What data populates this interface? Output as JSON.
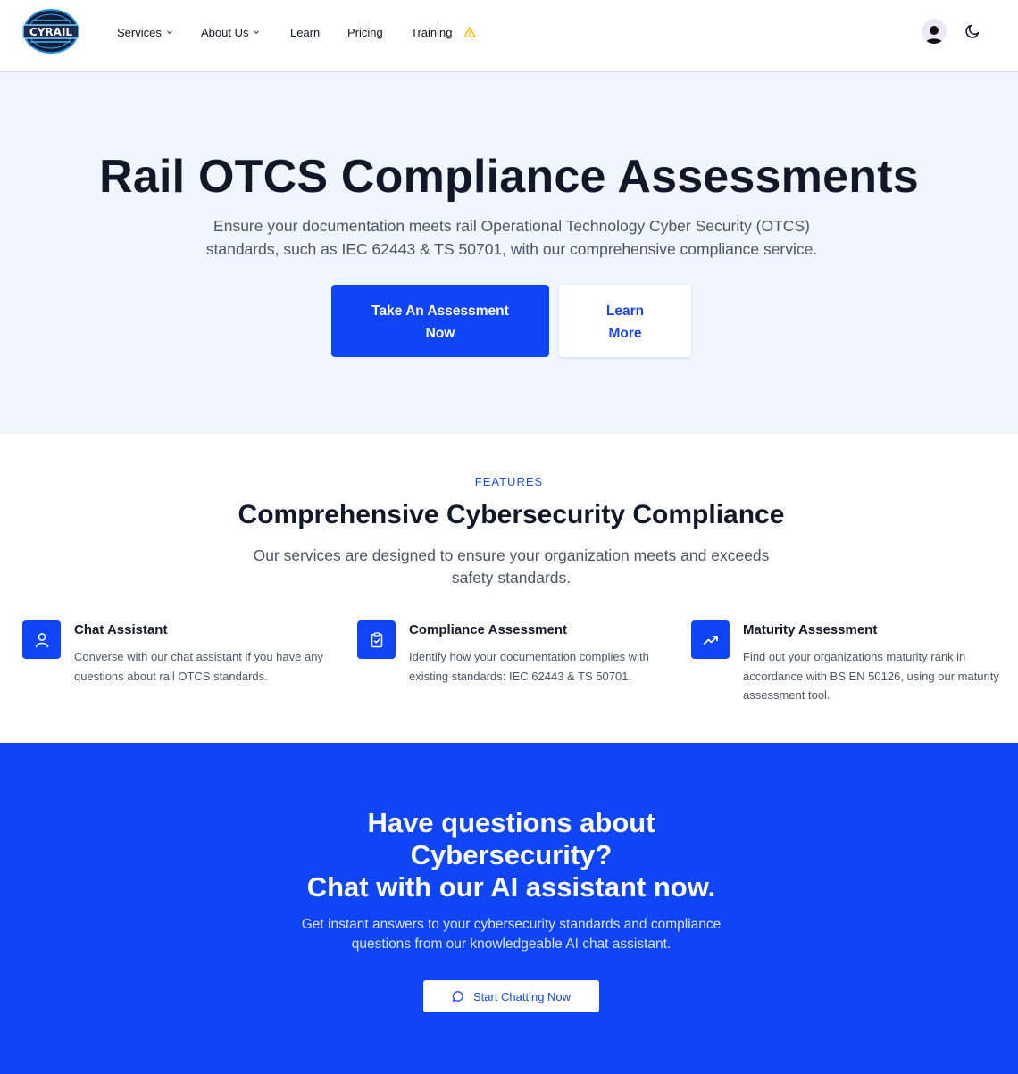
{
  "brand": {
    "logo_text": "CYRAIL"
  },
  "nav": {
    "items": [
      {
        "label": "Services"
      },
      {
        "label": "About Us"
      },
      {
        "label": "Learn"
      },
      {
        "label": "Pricing"
      },
      {
        "label": "Training"
      }
    ]
  },
  "hero": {
    "title": "Rail OTCS Compliance Assessments",
    "subtitle": "Ensure your documentation meets rail Operational Technology Cyber Security (OTCS) standards, such as IEC 62443 & TS 50701, with our comprehensive compliance service.",
    "primary_button": "Take An Assessment Now",
    "secondary_button": "Learn More"
  },
  "features": {
    "eyebrow": "FEATURES",
    "title": "Comprehensive Cybersecurity Compliance",
    "subtitle": "Our services are designed to ensure your organization meets and exceeds safety standards.",
    "cards": [
      {
        "icon": "user-icon",
        "title": "Chat Assistant",
        "description": "Converse with our chat assistant if you have any questions about rail OTCS standards."
      },
      {
        "icon": "clipboard-check-icon",
        "title": "Compliance Assessment",
        "description": "Identify how your documentation complies with existing standards: IEC 62443 & TS 50701."
      },
      {
        "icon": "trending-up-icon",
        "title": "Maturity Assessment",
        "description": "Find out your organizations maturity rank in accordance with BS EN 50126, using our maturity assessment tool."
      }
    ]
  },
  "cta": {
    "title_line1": "Have questions about",
    "title_line2": "Cybersecurity?",
    "title_line3": "Chat with our AI assistant now.",
    "subtitle": "Get instant answers to your cybersecurity standards and compliance questions from our knowledgeable AI chat assistant.",
    "button": "Start Chatting Now"
  },
  "colors": {
    "accent": "#0f45f4",
    "hero_bg": "#eff6ff",
    "warning": "#f5b800"
  }
}
